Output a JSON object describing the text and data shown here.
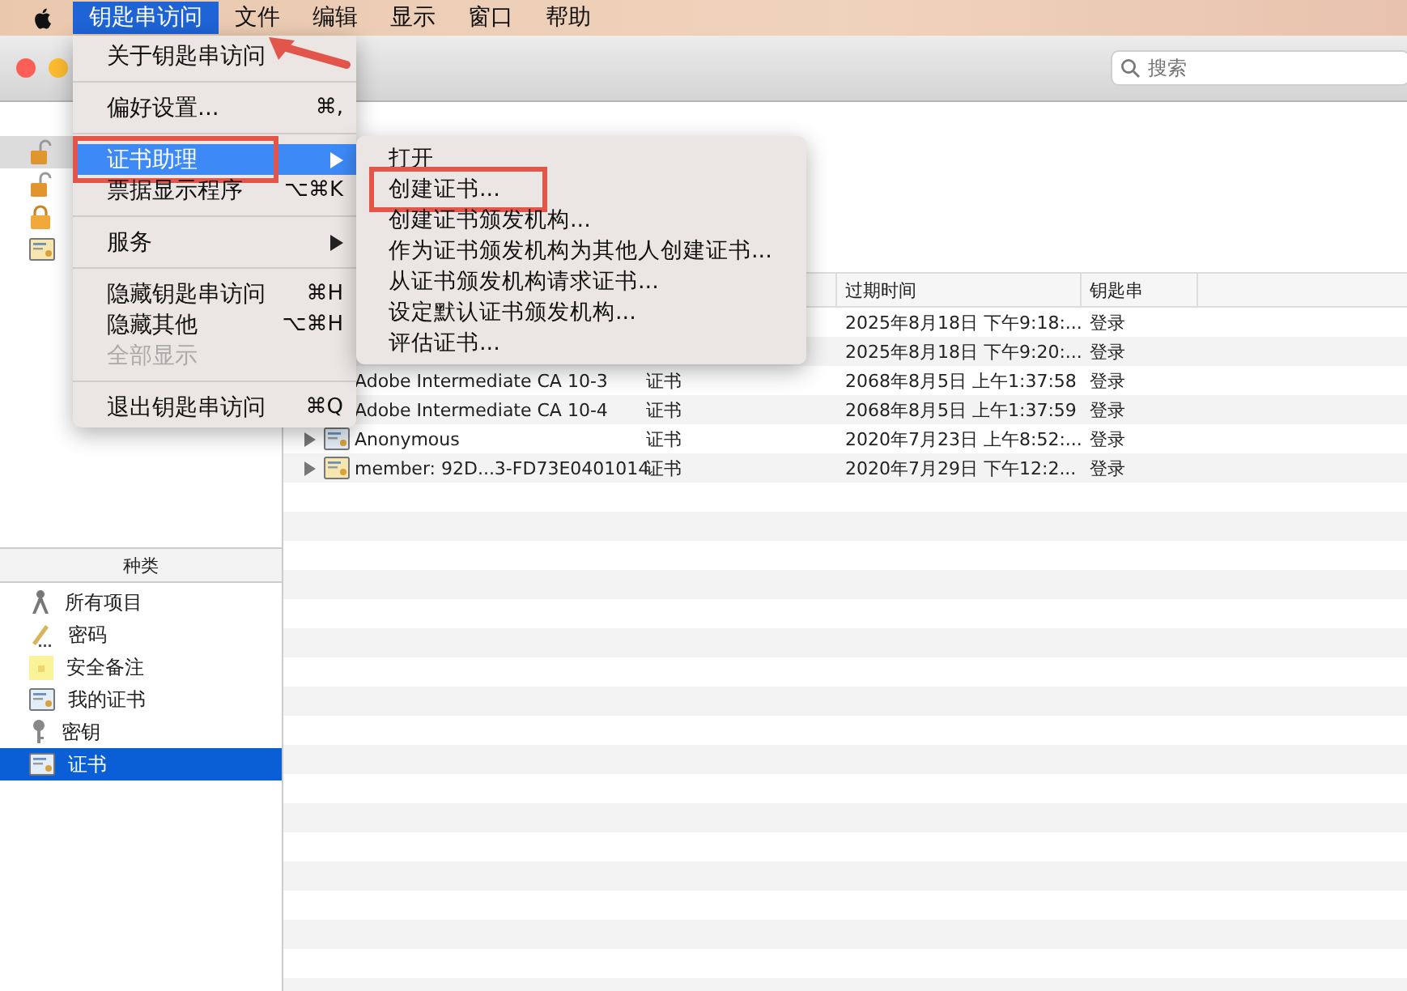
{
  "menu_bar": {
    "arrow_annotation": true,
    "items": [
      {
        "label": "钥匙串访问",
        "selected": true
      },
      {
        "label": "文件",
        "selected": false
      },
      {
        "label": "编辑",
        "selected": false
      },
      {
        "label": "显示",
        "selected": false
      },
      {
        "label": "窗口",
        "selected": false
      },
      {
        "label": "帮助",
        "selected": false
      }
    ]
  },
  "app_menu": {
    "groups": [
      [
        {
          "label": "关于钥匙串访问",
          "submenu": false,
          "selected": false,
          "disabled": false,
          "highlighted": false
        }
      ],
      [
        {
          "label": "偏好设置...",
          "shortcut": "⌘,",
          "submenu": false,
          "selected": false,
          "disabled": false,
          "highlighted": false
        }
      ],
      [
        {
          "label": "证书助理",
          "submenu": true,
          "selected": true,
          "disabled": false,
          "highlighted": true
        },
        {
          "label": "票据显示程序",
          "shortcut": "⌥⌘K",
          "submenu": false,
          "selected": false,
          "disabled": false,
          "highlighted": false
        }
      ],
      [
        {
          "label": "服务",
          "submenu": true,
          "selected": false,
          "disabled": false,
          "highlighted": false
        }
      ],
      [
        {
          "label": "隐藏钥匙串访问",
          "shortcut": "⌘H",
          "submenu": false,
          "selected": false,
          "disabled": false,
          "highlighted": false
        },
        {
          "label": "隐藏其他",
          "shortcut": "⌥⌘H",
          "submenu": false,
          "selected": false,
          "disabled": false,
          "highlighted": false
        },
        {
          "label": "全部显示",
          "submenu": false,
          "selected": false,
          "disabled": true,
          "highlighted": false
        }
      ],
      [
        {
          "label": "退出钥匙串访问",
          "shortcut": "⌘Q",
          "submenu": false,
          "selected": false,
          "disabled": false,
          "highlighted": false
        }
      ]
    ]
  },
  "submenu": {
    "items": [
      {
        "label": "打开",
        "highlighted": false
      },
      {
        "label": "创建证书...",
        "highlighted": true
      },
      {
        "label": "创建证书颁发机构...",
        "highlighted": false
      },
      {
        "label": "作为证书颁发机构为其他人创建证书...",
        "highlighted": false
      },
      {
        "label": "从证书颁发机构请求证书...",
        "highlighted": false
      },
      {
        "label": "设定默认证书颁发机构...",
        "highlighted": false
      },
      {
        "label": "评估证书...",
        "highlighted": false
      }
    ]
  },
  "toolbar": {
    "search": {
      "placeholder": "搜索"
    }
  },
  "sidebar": {
    "keychains": [
      {
        "kind": "unlocked",
        "selected": true
      },
      {
        "kind": "unlocked",
        "selected": false
      },
      {
        "kind": "locked",
        "selected": false
      },
      {
        "kind": "folder",
        "selected": false
      }
    ],
    "category_header": "种类",
    "categories": [
      {
        "label": "所有项目",
        "kind": "all",
        "selected": false
      },
      {
        "label": "密码",
        "kind": "password",
        "selected": false
      },
      {
        "label": "安全备注",
        "kind": "note",
        "selected": false
      },
      {
        "label": "我的证书",
        "kind": "mycert",
        "selected": false
      },
      {
        "label": "密钥",
        "kind": "key",
        "selected": false
      },
      {
        "label": "证书",
        "kind": "cert",
        "selected": true
      }
    ]
  },
  "table": {
    "columns": [
      "过期时间",
      "钥匙串"
    ],
    "rows": [
      {
        "expires": "2025年8月18日 下午9:18:...",
        "keychain": "登录"
      },
      {
        "expires": "2025年8月18日 下午9:20:...",
        "keychain": "登录"
      },
      {
        "name": "Adobe Intermediate CA 10-3",
        "kind": "证书",
        "expires": "2068年8月5日 上午1:37:58",
        "keychain": "登录"
      },
      {
        "name": "Adobe Intermediate CA 10-4",
        "kind": "证书",
        "expires": "2068年8月5日 上午1:37:59",
        "keychain": "登录"
      },
      {
        "name": "Anonymous",
        "kind": "证书",
        "expanded": false,
        "expires": "2020年7月23日 上午8:52:...",
        "keychain": "登录"
      },
      {
        "name": "member: 92D...3-FD73E0401014",
        "kind": "证书",
        "expanded": false,
        "expires": "2020年7月29日 下午12:2...",
        "keychain": "登录"
      }
    ]
  }
}
